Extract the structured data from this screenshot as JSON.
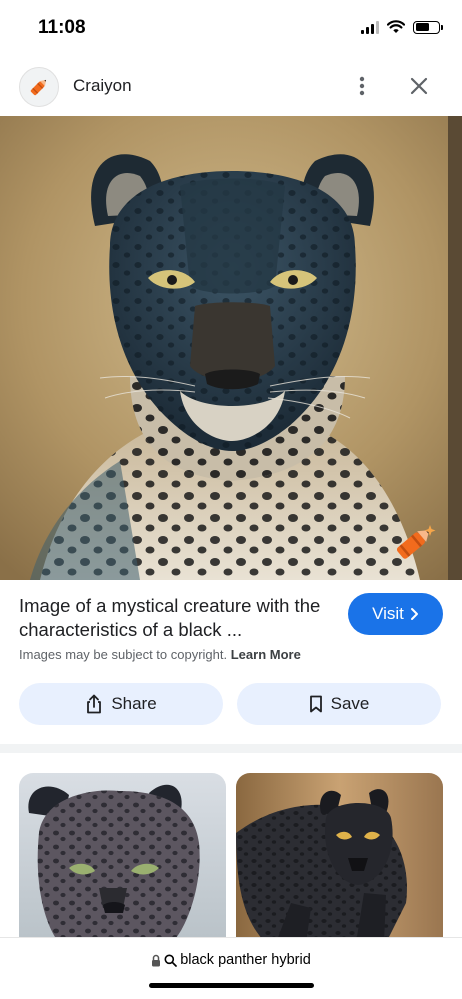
{
  "status_bar": {
    "time": "11:08",
    "signal_bars": 3,
    "battery_level": 0.6
  },
  "header": {
    "site_name": "Craiyon",
    "logo_icon": "craiyon-crayon-logo",
    "more_icon": "more-vertical-icon",
    "close_icon": "close-icon"
  },
  "image": {
    "title": "Image of a mystical creature with the characteristics of a black ...",
    "visit_label": "Visit",
    "copyright_text": "Images may be subject to copyright.",
    "learn_more_label": "Learn More",
    "share_label": "Share",
    "save_label": "Save"
  },
  "related": [
    {
      "icon": "related-panther-image"
    },
    {
      "icon": "related-black-panther-image"
    }
  ],
  "bottom_bar": {
    "url": "black panther hybrid",
    "lock_icon": "lock-icon",
    "search_icon": "search-icon"
  },
  "colors": {
    "accent": "#1a73e8",
    "action_button_bg": "#e8f0fe",
    "craiyon_orange": "#f26b1d"
  }
}
